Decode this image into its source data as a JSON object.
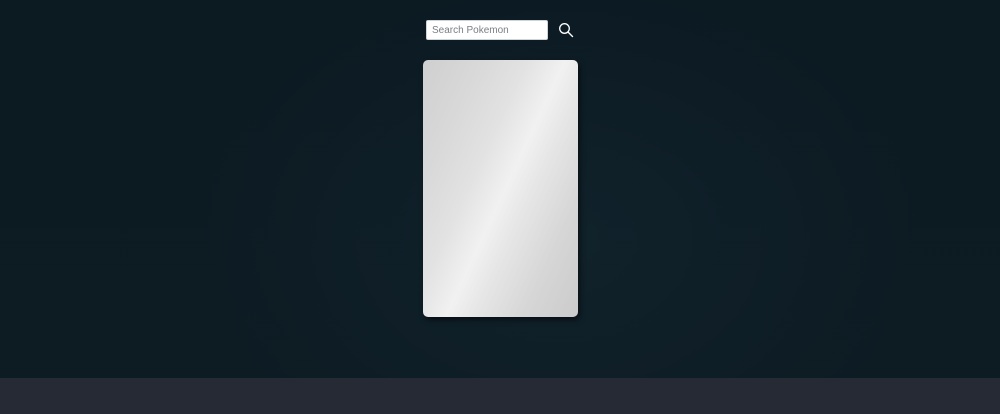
{
  "search": {
    "placeholder": "Search Pokemon",
    "value": "",
    "button_icon": "search-icon"
  },
  "card": {
    "state": "blank"
  },
  "colors": {
    "background": "#0d1a22",
    "footer": "#252a35",
    "card_silver": "#e2e2e2",
    "search_icon": "#ffffff"
  }
}
